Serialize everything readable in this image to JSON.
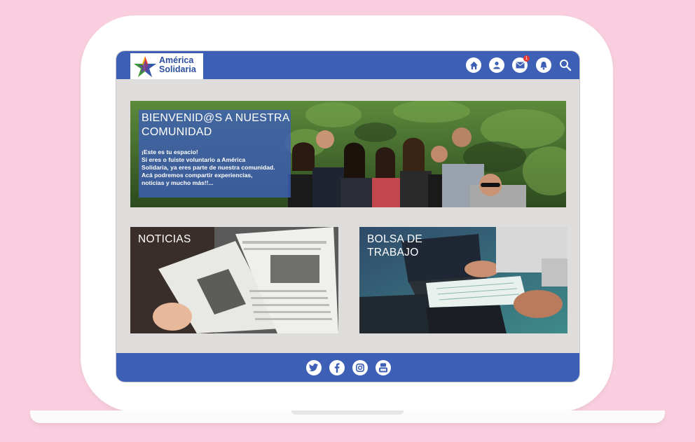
{
  "header": {
    "logo": {
      "line1": "América",
      "line2": "Solidaria"
    },
    "nav_icons": [
      "home-icon",
      "user-icon",
      "mail-icon",
      "bell-icon",
      "search-icon"
    ],
    "mail_badge": "1"
  },
  "hero": {
    "title_line1": "BIENVENID@S A NUESTRA",
    "title_line2": "COMUNIDAD",
    "text_lines": [
      "¡Este es tu espacio!",
      "Si eres o fuiste voluntario a América",
      "Solidaria, ya eres parte de nuestra comunidad.",
      "Acá podremos compartir experiencias,",
      "noticias y mucho más!!..."
    ]
  },
  "cards": {
    "news_title": "NOTICIAS",
    "jobs_title_line1": "BOLSA DE",
    "jobs_title_line2": "TRABAJO"
  },
  "footer": {
    "social_icons": [
      "twitter-icon",
      "facebook-icon",
      "instagram-icon",
      "youtube-icon"
    ]
  },
  "colors": {
    "brand_blue": "#3d5fb5",
    "background_pink": "#f9cfdf",
    "screen_gray": "#dfdcdc"
  }
}
